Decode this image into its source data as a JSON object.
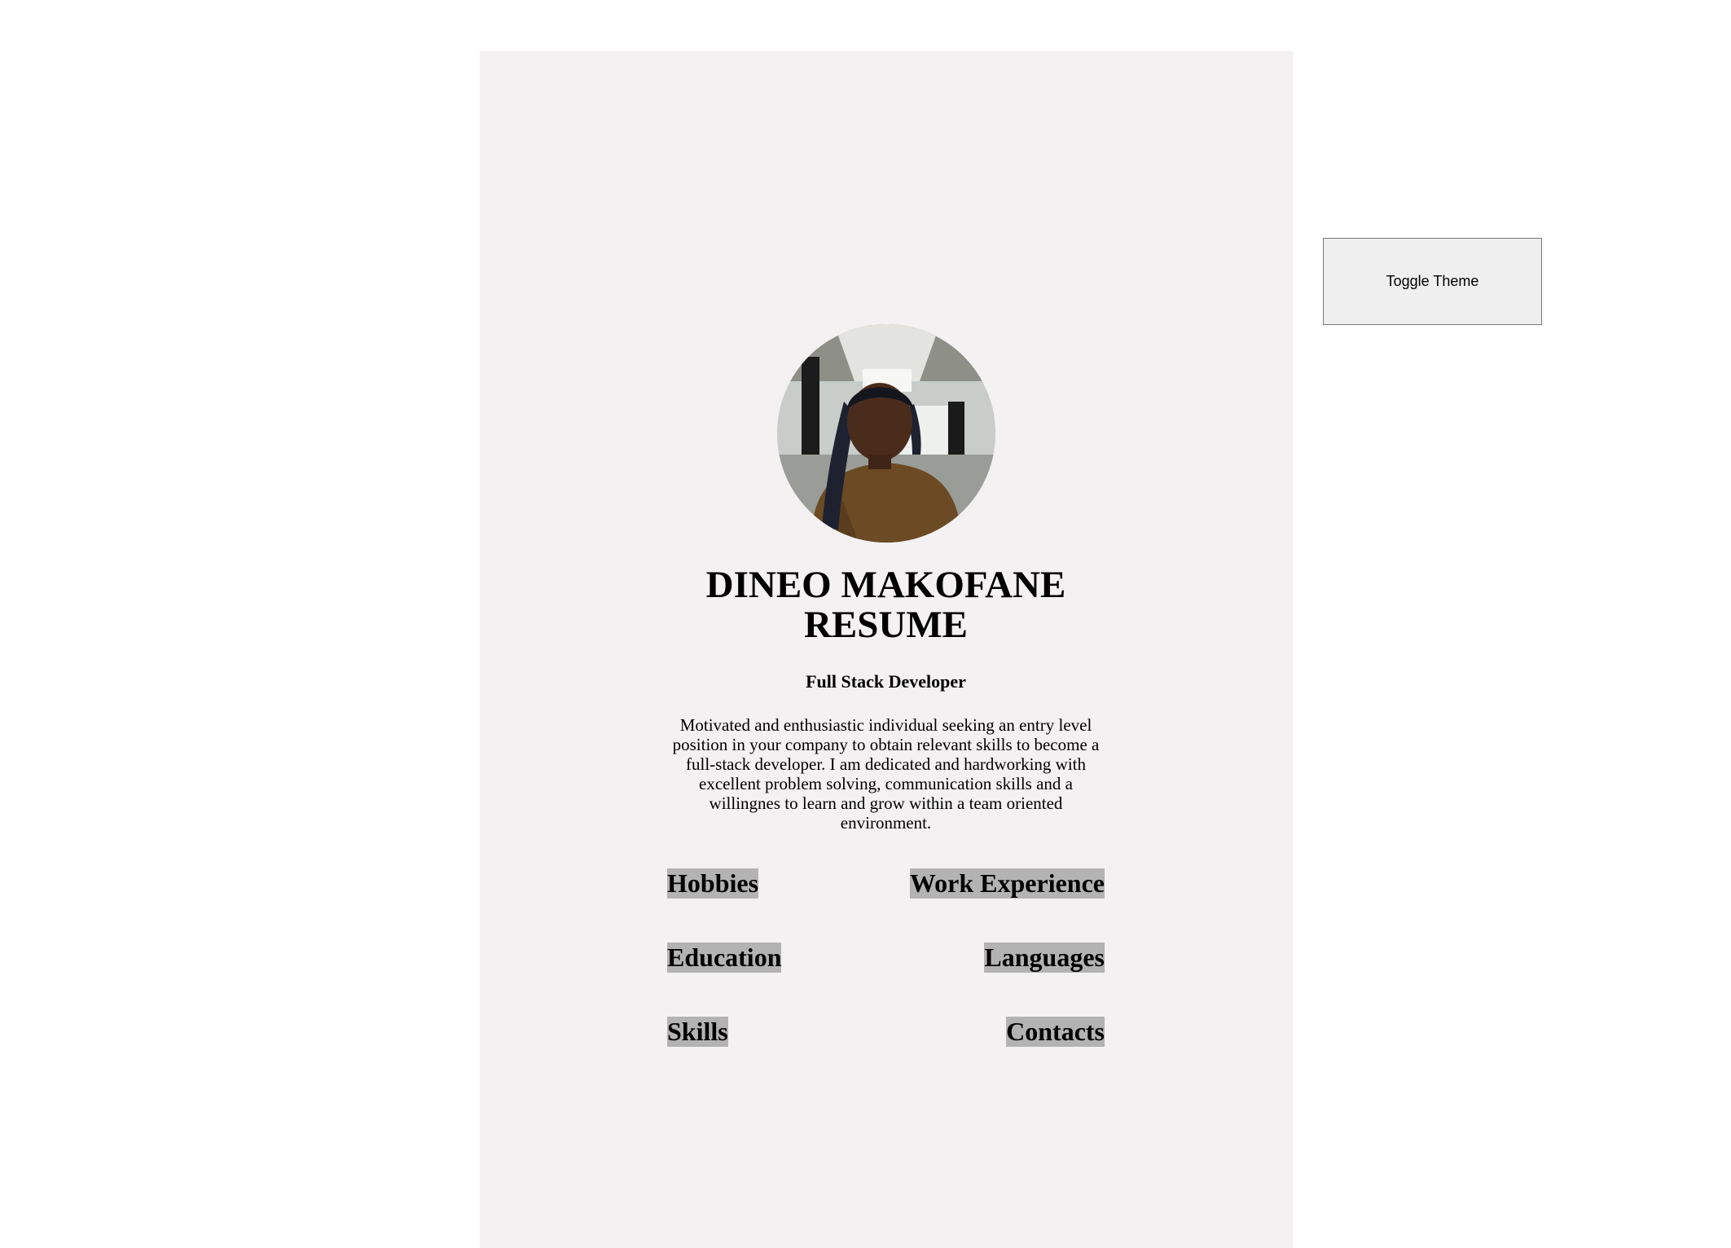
{
  "resume": {
    "title": "DINEO MAKOFANE RESUME",
    "role": "Full Stack Developer",
    "summary": "Motivated and enthusiastic individual seeking an entry level position in your company to obtain relevant skills to become a full-stack developer. I am dedicated and hardworking with excellent problem solving, communication skills and a willingnes to learn and grow within a team oriented environment.",
    "profile_photo": "profile-photo",
    "sections": [
      {
        "label": "Hobbies"
      },
      {
        "label": "Work Experience"
      },
      {
        "label": "Education"
      },
      {
        "label": "Languages"
      },
      {
        "label": "Skills"
      },
      {
        "label": "Contacts"
      }
    ]
  },
  "controls": {
    "toggle_theme_label": "Toggle Theme"
  },
  "colors": {
    "page_background": "#ffffff",
    "panel_background": "#f3f1f2",
    "section_highlight": "#b3b3b3",
    "button_background": "#efefef"
  }
}
